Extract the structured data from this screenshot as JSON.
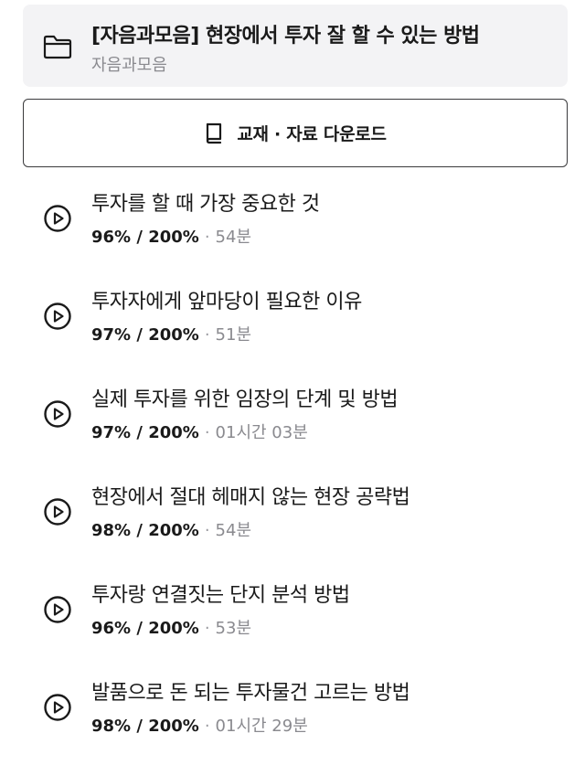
{
  "course": {
    "title": "[자음과모음] 현장에서 투자 잘 할 수 있는 방법",
    "author": "자음과모음",
    "icon": "folder-icon"
  },
  "download": {
    "label": "교재 · 자료 다운로드",
    "icon": "book-icon"
  },
  "lessons": [
    {
      "title": "투자를 할 때 가장 중요한 것",
      "progress": "96% / 200%",
      "separator": "·",
      "duration": "54분"
    },
    {
      "title": "투자자에게 앞마당이 필요한 이유",
      "progress": "97% / 200%",
      "separator": "·",
      "duration": "51분"
    },
    {
      "title": "실제 투자를 위한 임장의 단계 및 방법",
      "progress": "97% / 200%",
      "separator": "·",
      "duration": "01시간 03분"
    },
    {
      "title": "현장에서 절대 헤매지 않는 현장 공략법",
      "progress": "98% / 200%",
      "separator": "·",
      "duration": "54분"
    },
    {
      "title": "투자랑 연결짓는 단지 분석 방법",
      "progress": "96% / 200%",
      "separator": "·",
      "duration": "53분"
    },
    {
      "title": "발품으로 돈 되는 투자물건 고르는 방법",
      "progress": "98% / 200%",
      "separator": "·",
      "duration": "01시간 29분"
    }
  ],
  "colors": {
    "card_background": "#f3f3f5",
    "text_primary": "#1a1a1a",
    "text_secondary": "#8a8a8f",
    "border": "#3a3a3c"
  }
}
